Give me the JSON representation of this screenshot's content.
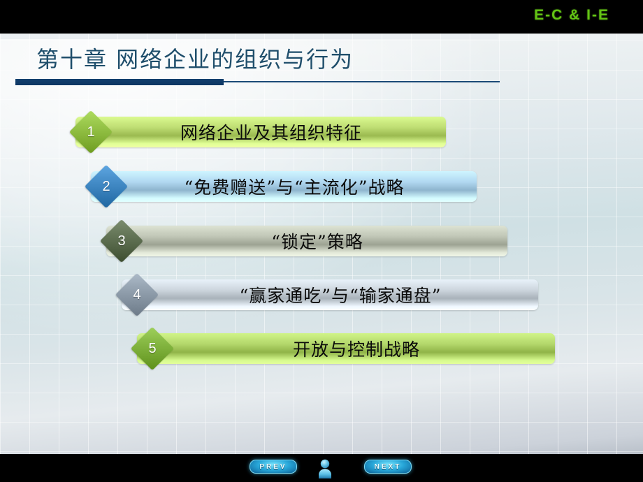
{
  "brand": {
    "text": "E-C & I-E",
    "color": "#63c414"
  },
  "slide": {
    "title": "第十章 网络企业的组织与行为",
    "title_color": "#1f4e6b",
    "rule_color": "#12406e"
  },
  "agenda": {
    "items": [
      {
        "number": "1",
        "label": "网络企业及其组织特征",
        "diamond_color": "#8cba3e",
        "bar_color": "#b5d46a"
      },
      {
        "number": "2",
        "label": "“免费赠送”与“主流化”战略",
        "diamond_color": "#3c84bf",
        "bar_color": "#a8cfe8"
      },
      {
        "number": "3",
        "label": "“锁定”策略",
        "diamond_color": "#5a6b4d",
        "bar_color": "#b7bdad"
      },
      {
        "number": "4",
        "label": "“赢家通吃”与“输家通盘”",
        "diamond_color": "#8a98a6",
        "bar_color": "#c3ccd4"
      },
      {
        "number": "5",
        "label": "开放与控制战略",
        "diamond_color": "#7cae39",
        "bar_color": "#aace62"
      }
    ]
  },
  "nav": {
    "prev_label": "PREV",
    "next_label": "NEXT",
    "avatar_icon": "user-avatar-icon",
    "accent": "#27a6d8"
  }
}
